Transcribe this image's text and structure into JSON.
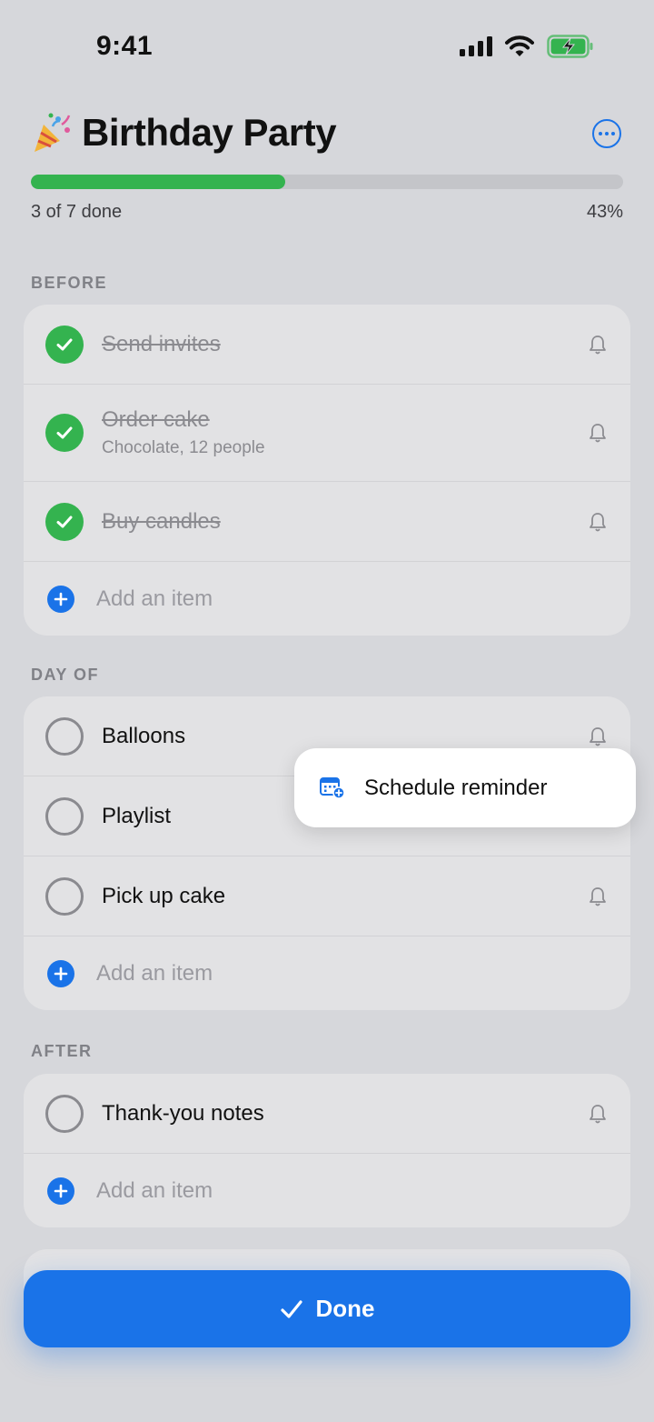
{
  "status_bar": {
    "time": "9:41",
    "icons": [
      "cellular-signal-icon",
      "wifi-icon",
      "battery-charging-icon"
    ],
    "battery_color": "#34b34f"
  },
  "header": {
    "emoji_icon": "party-popper-icon",
    "title": "Birthday Party",
    "more_icon": "more-options-icon"
  },
  "progress": {
    "completed": 3,
    "total": 7,
    "fraction": 0.43,
    "label": "3 of 7 done",
    "percent_label": "43%",
    "fill_color": "#34b34f"
  },
  "sections": [
    {
      "label": "BEFORE",
      "items": [
        {
          "title": "Send invites",
          "done": true
        },
        {
          "title": "Order cake",
          "subtitle": "Chocolate, 12 people",
          "done": true
        },
        {
          "title": "Buy candles",
          "done": true
        }
      ],
      "add_label": "Add an item"
    },
    {
      "label": "DAY OF",
      "items": [
        {
          "title": "Balloons",
          "done": false
        },
        {
          "title": "Playlist",
          "done": false
        },
        {
          "title": "Pick up cake",
          "done": false
        }
      ],
      "add_label": "Add an item"
    },
    {
      "label": "AFTER",
      "items": [
        {
          "title": "Thank-you notes",
          "done": false
        }
      ],
      "add_label": "Add an item"
    }
  ],
  "popover": {
    "icon": "calendar-add-icon",
    "label": "Schedule reminder"
  },
  "done_button": {
    "icon": "checkmark-icon",
    "label": "Done",
    "color": "#1a73e8"
  }
}
